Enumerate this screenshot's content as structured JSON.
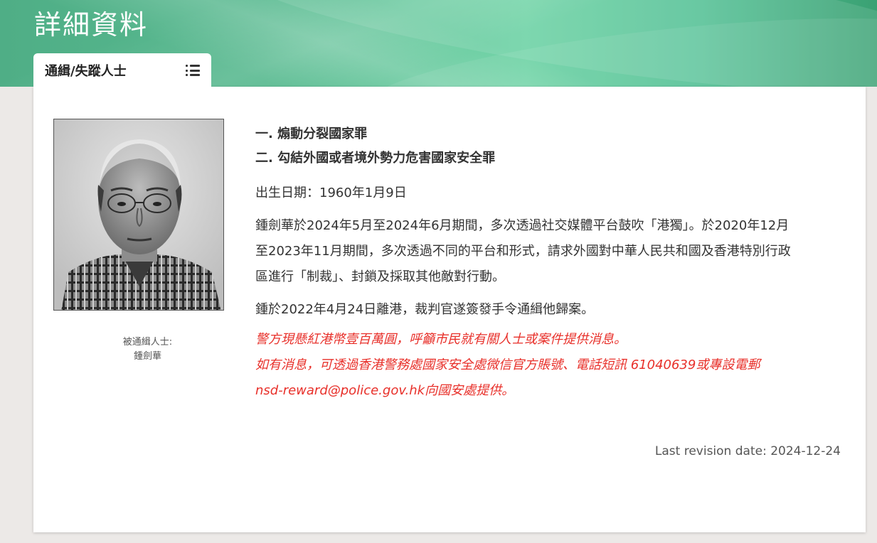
{
  "page": {
    "title": "詳細資料"
  },
  "tab": {
    "label": "通緝/失蹤人士",
    "icon": "list-icon"
  },
  "profile": {
    "caption_label": "被通緝人士:",
    "name": "鍾劍華"
  },
  "details": {
    "charges": [
      "一. 煽動分裂國家罪",
      "二. 勾結外國或者境外勢力危害國家安全罪"
    ],
    "dob": "出生日期：1960年1月9日",
    "paragraph1_line1": "鍾劍華於2024年5月至2024年6月期間，多次透過社交媒體平台鼓吹「港獨」。於2020年12月",
    "paragraph1_line2": "至2023年11月期間，多次透過不同的平台和形式，請求外國對中華人民共和國及香港特別行政",
    "paragraph1_line3": "區進行「制裁」、封鎖及採取其他敵對行動。",
    "paragraph2": "鍾於2022年4月24日離港，裁判官遂簽發手令通緝他歸案。",
    "reward_line1": "警方現懸紅港幣壹百萬圓，呼籲市民就有關人士或案件提供消息。",
    "reward_line2": "如有消息，可透過香港警務處國家安全處微信官方賬號、電話短訊 61040639或專設電郵",
    "reward_line3": "nsd-reward@police.gov.hk向國安處提供。"
  },
  "footer": {
    "revision": "Last revision date: 2024-12-24"
  },
  "colors": {
    "banner_green": "#57b98f",
    "reward_red": "#e8302a"
  }
}
